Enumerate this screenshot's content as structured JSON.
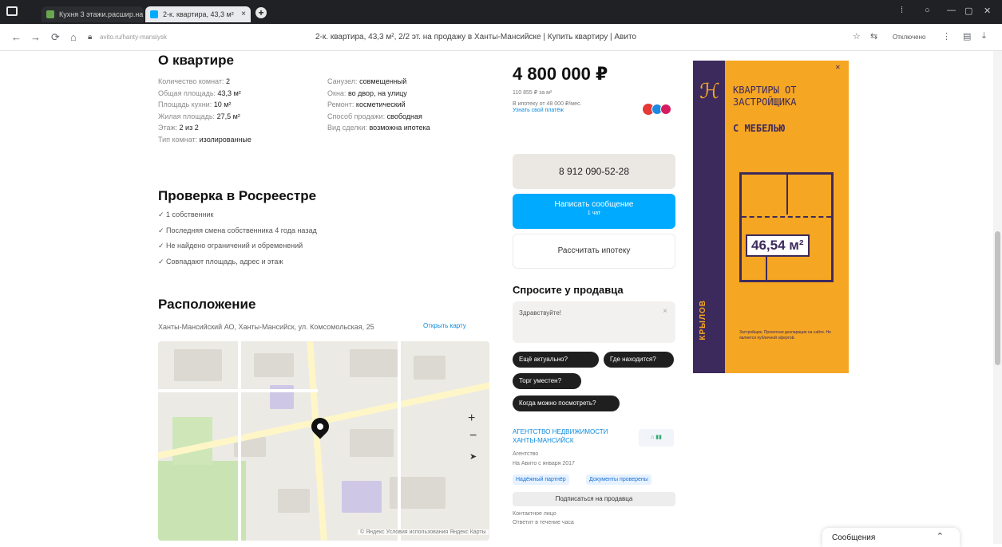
{
  "browser": {
    "tabs": [
      {
        "label": "Кухня 3 этажи.расшир.на",
        "active": false
      },
      {
        "label": "2-к. квартира, 43,3 м²",
        "active": true
      }
    ],
    "url": "2-к. квартира, 43,3 м², 2/2 эт. на продажу в Ханты-Мансийске | Купить квартиру | Авито",
    "address_host": "avito.ru/hanty-mansiysk",
    "profile_label": "Отключено"
  },
  "about": {
    "title": "О квартире",
    "left": [
      {
        "label": "Количество комнат:",
        "value": "2"
      },
      {
        "label": "Общая площадь:",
        "value": "43,3 м²"
      },
      {
        "label": "Площадь кухни:",
        "value": "10 м²"
      },
      {
        "label": "Жилая площадь:",
        "value": "27,5 м²"
      },
      {
        "label": "Этаж:",
        "value": "2 из 2"
      },
      {
        "label": "Тип комнат:",
        "value": "изолированные"
      }
    ],
    "right": [
      {
        "label": "Санузел:",
        "value": "совмещенный"
      },
      {
        "label": "Окна:",
        "value": "во двор, на улицу"
      },
      {
        "label": "Ремонт:",
        "value": "косметический"
      },
      {
        "label": "Способ продажи:",
        "value": "свободная"
      },
      {
        "label": "Вид сделки:",
        "value": "возможна ипотека"
      }
    ]
  },
  "rosreestr": {
    "title": "Проверка в Росреестре",
    "items": [
      "✓ 1 собственник",
      "✓ Последняя смена собственника 4 года назад",
      "✓ Не найдено ограничений и обременений",
      "✓ Совпадают площадь, адрес и этаж"
    ]
  },
  "location": {
    "title": "Расположение",
    "address": "Ханты-Мансийский АО, Ханты-Мансийск, ул. Комсомольская, 25",
    "map_link": "Открыть карту",
    "map_footer": "© Яндекс  Условия использования  Яндекс Карты"
  },
  "sidebar": {
    "price": "4 800 000 ₽",
    "price_per_m2": "110 855 ₽ за м²",
    "mortgage": "В ипотеку от 48 000 ₽/мес.",
    "mortgage_link": "Узнать свой платёж",
    "phone": "8 912 090-52-28",
    "write_button": "Написать сообщение",
    "write_sub": "1 чат",
    "calc_button": "Рассчитать ипотеку",
    "ask_title": "Спросите у продавца",
    "ask_placeholder": "Здравствуйте!",
    "chips": [
      "Ещё актуально?",
      "Где находится?",
      "Торг уместен?",
      "Когда можно посмотреть?"
    ],
    "seller_name": "АГЕНТСТВО НЕДВИЖИМОСТИ ХАНТЫ-МАНСИЙСК",
    "seller_type": "Агентство",
    "seller_since": "На Авито с января 2017",
    "seller_tags": [
      "Надёжный партнёр",
      "Документы проверены"
    ],
    "subscribe": "Подписаться на продавца",
    "seller_note1": "Контактное лицо",
    "seller_note2": "Ответит в течение часа"
  },
  "ad": {
    "title": "КВАРТИРЫ ОТ ЗАСТРОЙЩИКА",
    "subtitle": "С МЕБЕЛЬЮ",
    "area": "46,54 м²",
    "brand": "КРЫЛОВ",
    "fine_print": "Застройщик. Проектная декларация на сайте. Не является публичной офертой."
  },
  "messages_widget": {
    "label": "Сообщения"
  },
  "colors": {
    "accent": "#00aaff",
    "ad_orange": "#f5a623",
    "ad_purple": "#3d2a5c"
  }
}
